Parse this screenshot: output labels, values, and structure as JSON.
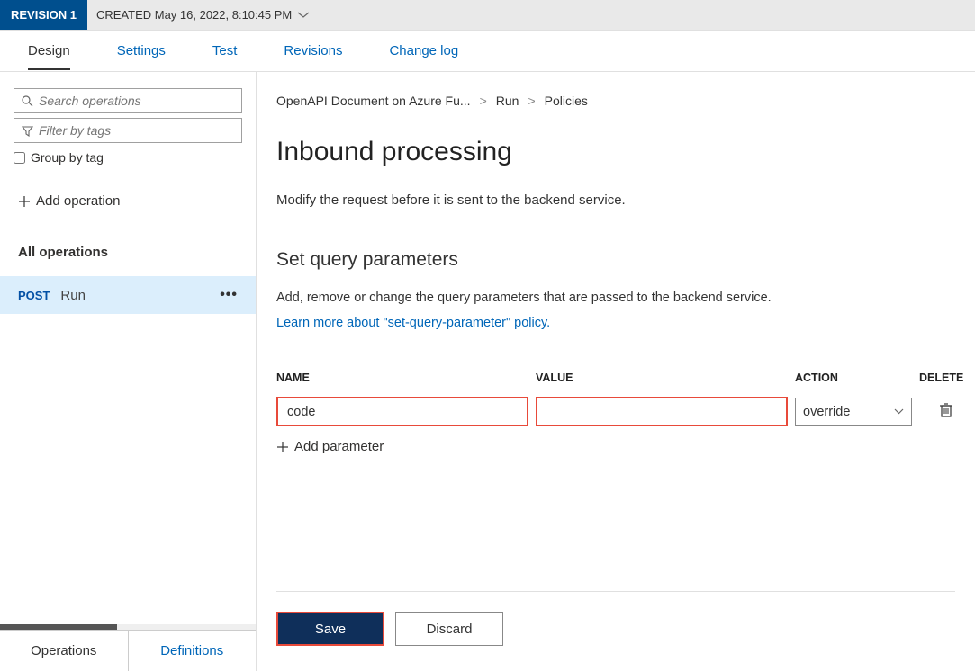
{
  "topbar": {
    "revision_badge": "REVISION 1",
    "created_label": "CREATED May 16, 2022, 8:10:45 PM"
  },
  "tabs": {
    "design": "Design",
    "settings": "Settings",
    "test": "Test",
    "revisions": "Revisions",
    "changelog": "Change log"
  },
  "sidebar": {
    "search_placeholder": "Search operations",
    "filter_placeholder": "Filter by tags",
    "group_label": "Group by tag",
    "add_operation": "Add operation",
    "all_operations": "All operations",
    "op_method": "POST",
    "op_name": "Run",
    "bottom_tabs": {
      "operations": "Operations",
      "definitions": "Definitions"
    }
  },
  "breadcrumb": {
    "a": "OpenAPI Document on Azure Fu...",
    "b": "Run",
    "c": "Policies"
  },
  "main": {
    "title": "Inbound processing",
    "subtitle": "Modify the request before it is sent to the backend service.",
    "section_title": "Set query parameters",
    "section_desc": "Add, remove or change the query parameters that are passed to the backend service.",
    "learn_more": "Learn more about \"set-query-parameter\" policy.",
    "columns": {
      "name": "NAME",
      "value": "VALUE",
      "action": "ACTION",
      "delete": "DELETE"
    },
    "row": {
      "name": "code",
      "value": "",
      "action": "override"
    },
    "add_parameter": "Add parameter"
  },
  "footer": {
    "save": "Save",
    "discard": "Discard"
  }
}
